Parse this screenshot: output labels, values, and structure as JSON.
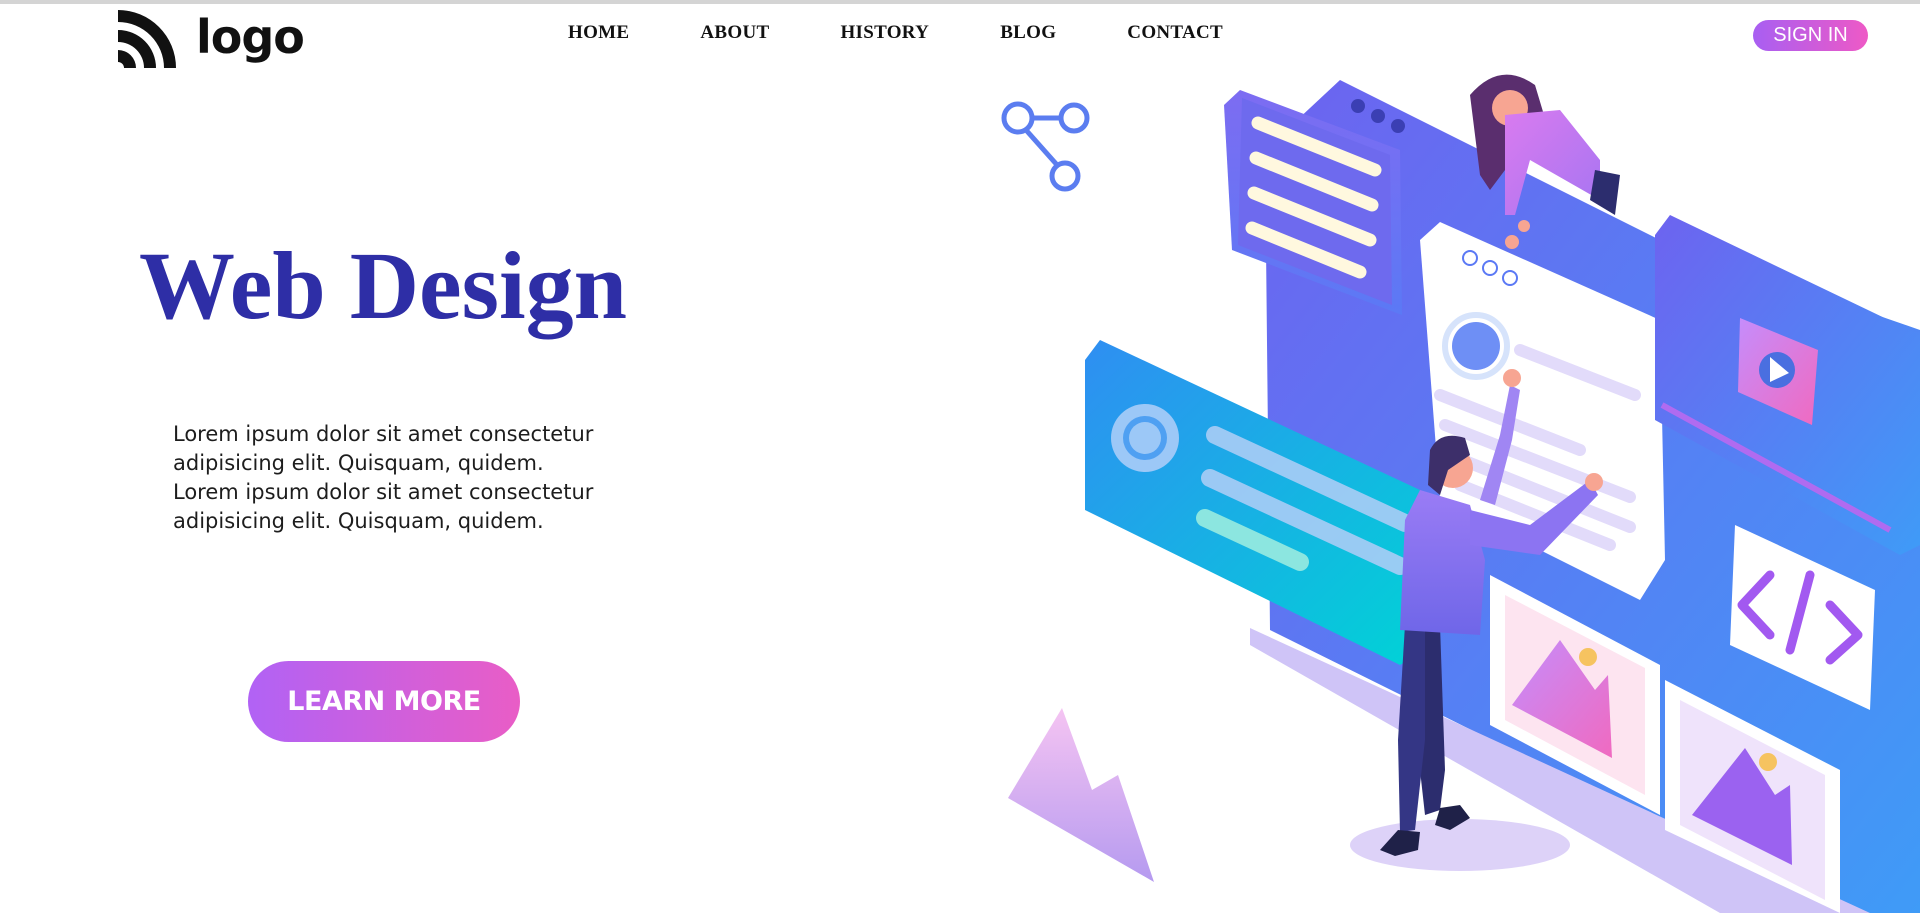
{
  "header": {
    "logo_text": "logo",
    "logo_icon": "wifi-arcs-icon",
    "nav": [
      {
        "label": "HOME"
      },
      {
        "label": "ABOUT"
      },
      {
        "label": "HISTORY"
      },
      {
        "label": "BLOG"
      },
      {
        "label": "CONTACT"
      }
    ],
    "signin_label": "SIGN IN"
  },
  "hero": {
    "title": "Web Design",
    "text": "Lorem ipsum dolor sit amet consectetur adipisicing elit. Quisquam, quidem. Lorem ipsum dolor sit amet consectetur adipisicing elit. Quisquam, quidem.",
    "cta_label": "LEARN MORE"
  },
  "illustration": {
    "name": "isometric-web-design-illustration",
    "icons": [
      "share-icon",
      "gear-icon",
      "code-icon",
      "play-icon",
      "image-icon"
    ]
  },
  "colors": {
    "title": "#2e2ea6",
    "button_gradient_start": "#a85ff2",
    "button_gradient_end": "#ee59c6"
  }
}
